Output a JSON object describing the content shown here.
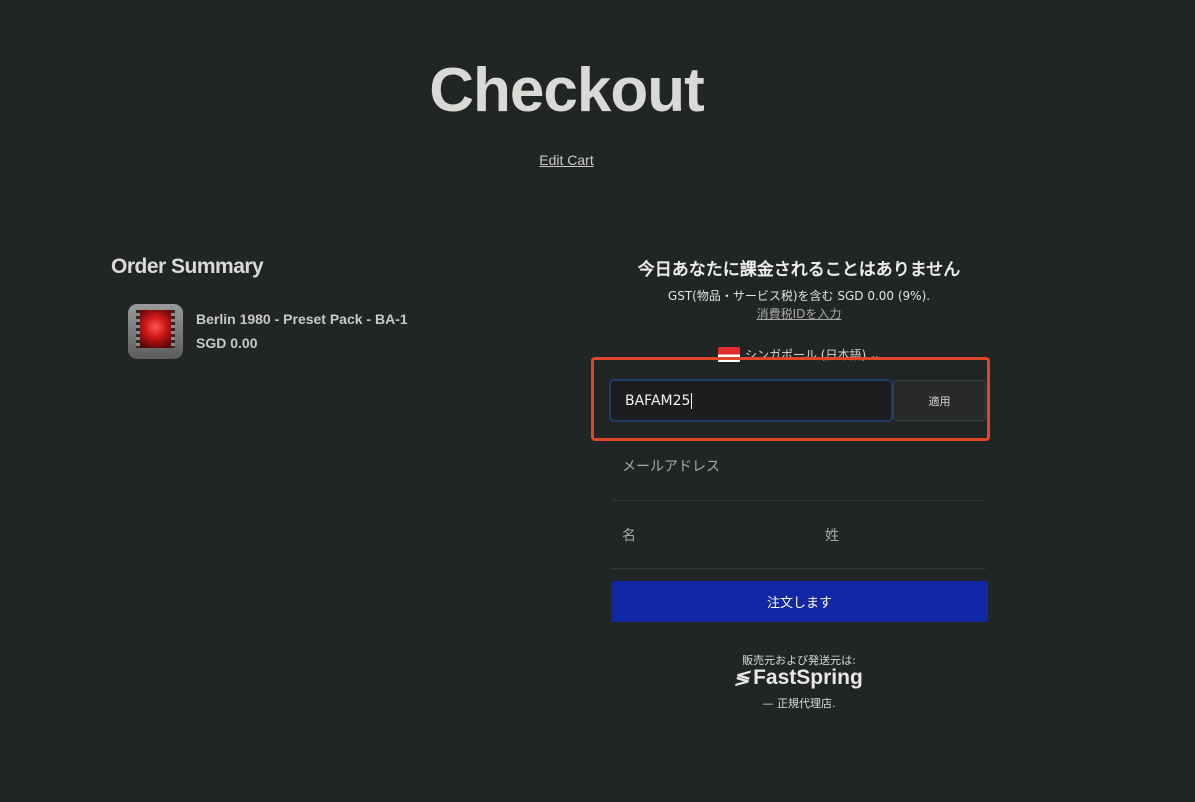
{
  "page": {
    "title": "Checkout",
    "edit_cart": "Edit Cart"
  },
  "order_summary": {
    "heading": "Order Summary",
    "items": [
      {
        "name": "Berlin 1980 - Preset Pack - BA-1",
        "price": "SGD 0.00"
      }
    ]
  },
  "payment": {
    "charge_heading": "今日あなたに課金されることはありません",
    "gst_line": "GST(物品・サービス税)を含む SGD 0.00 (9%).",
    "tax_id_link": "消費税IDを入力",
    "country_label": "シンガポール (日本語)",
    "country_caret": "⌄",
    "coupon": {
      "value": "BAFAM25",
      "apply_label": "適用"
    },
    "email_placeholder": "メールアドレス",
    "first_name_placeholder": "名",
    "last_name_placeholder": "姓",
    "order_button": "注文します"
  },
  "footer": {
    "seller_line": "販売元および発送元は:",
    "brand": "FastSpring",
    "authorized_line": "— 正規代理店."
  },
  "colors": {
    "background": "#222526",
    "accent_button": "#1226a6",
    "highlight_border": "#e0462a",
    "input_focus_border": "#1e3d66"
  },
  "icons": {
    "flag": "singapore-flag-icon",
    "brand_mark": "fastspring-logo-icon"
  }
}
